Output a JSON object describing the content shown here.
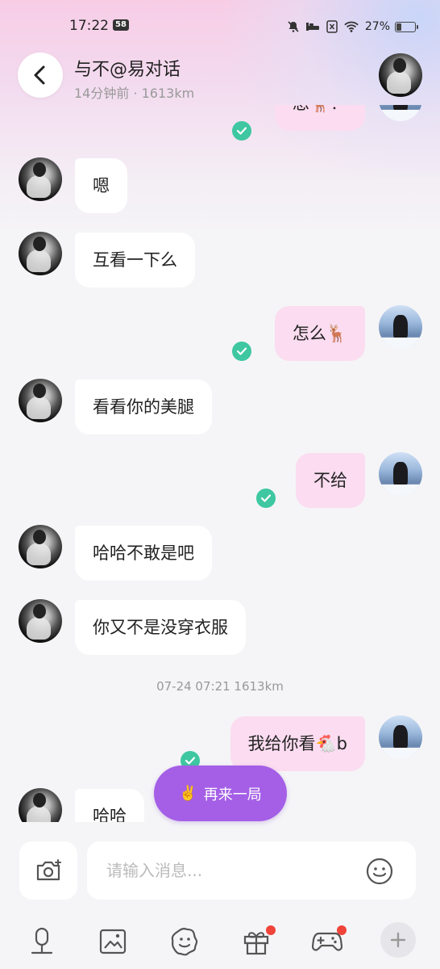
{
  "status_bar": {
    "time": "17:22",
    "badge": "58",
    "battery": "27%",
    "battery_level": 0.27
  },
  "header": {
    "title": "与不@易对话",
    "subtitle": "14分钟前 · 1613km"
  },
  "messages": [
    {
      "side": "out",
      "text": "想🦌？",
      "read": true
    },
    {
      "side": "in",
      "text": "嗯"
    },
    {
      "side": "in",
      "text": "互看一下么"
    },
    {
      "side": "out",
      "text": "怎么🦌",
      "read": true
    },
    {
      "side": "in",
      "text": "看看你的美腿"
    },
    {
      "side": "out",
      "text": "不给",
      "read": true
    },
    {
      "side": "in",
      "text": "哈哈不敢是吧"
    },
    {
      "side": "in",
      "text": "你又不是没穿衣服"
    },
    {
      "side": "out",
      "text": "我给你看🐔b",
      "read": true
    },
    {
      "side": "in",
      "text": "哈哈"
    }
  ],
  "timestamp": "07-24 07:21  1613km",
  "replay_button": {
    "emoji": "✌️",
    "label": "再来一局"
  },
  "input": {
    "placeholder": "请输入消息..."
  },
  "toolbar": {
    "icons": [
      "voice-icon",
      "image-icon",
      "sticker-icon",
      "gift-icon",
      "game-icon",
      "plus-icon"
    ]
  },
  "colors": {
    "accent_purple": "#a45fe6",
    "read_check": "#3ec7a1",
    "outgoing_bubble": "#fbdcf0",
    "badge_red": "#f0443a"
  }
}
